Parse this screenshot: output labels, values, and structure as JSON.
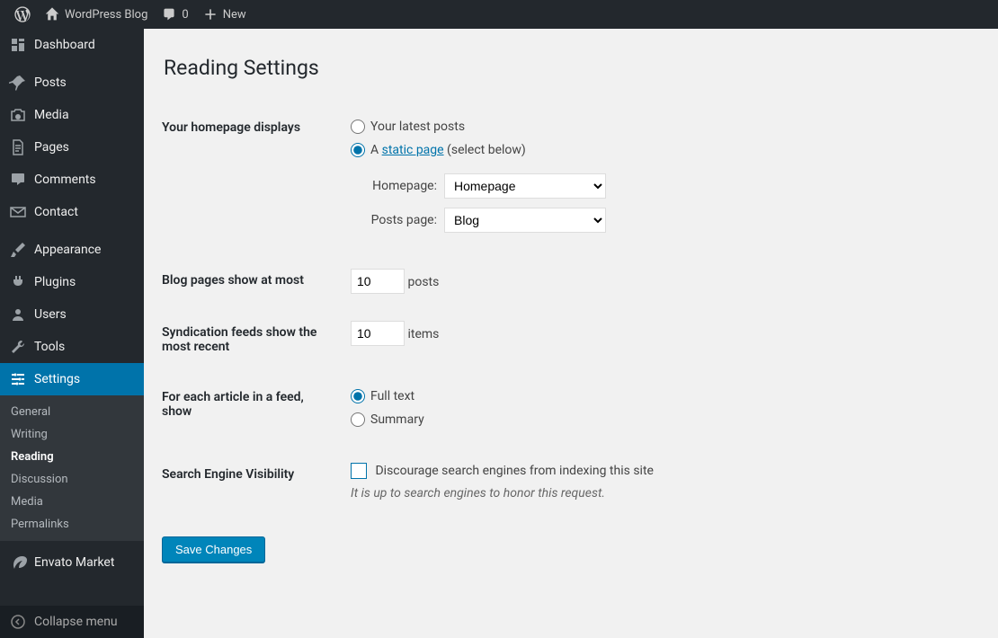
{
  "toolbar": {
    "site_name": "WordPress Blog",
    "comments_count": "0",
    "new_label": "New"
  },
  "sidebar": {
    "items": [
      {
        "label": "Dashboard"
      },
      {
        "label": "Posts"
      },
      {
        "label": "Media"
      },
      {
        "label": "Pages"
      },
      {
        "label": "Comments"
      },
      {
        "label": "Contact"
      },
      {
        "label": "Appearance"
      },
      {
        "label": "Plugins"
      },
      {
        "label": "Users"
      },
      {
        "label": "Tools"
      },
      {
        "label": "Settings"
      },
      {
        "label": "Envato Market"
      }
    ],
    "settings_sub": [
      {
        "label": "General"
      },
      {
        "label": "Writing"
      },
      {
        "label": "Reading"
      },
      {
        "label": "Discussion"
      },
      {
        "label": "Media"
      },
      {
        "label": "Permalinks"
      }
    ],
    "collapse_label": "Collapse menu"
  },
  "page": {
    "title": "Reading Settings",
    "homepage_th": "Your homepage displays",
    "homepage_opt_latest": "Your latest posts",
    "homepage_opt_static_prefix": "A ",
    "homepage_opt_static_link": "static page",
    "homepage_opt_static_suffix": " (select below)",
    "homepage_label": "Homepage:",
    "homepage_select": "Homepage",
    "posts_page_label": "Posts page:",
    "posts_page_select": "Blog",
    "blog_pages_th": "Blog pages show at most",
    "blog_pages_value": "10",
    "blog_pages_unit": "posts",
    "syndication_th": "Syndication feeds show the most recent",
    "syndication_value": "10",
    "syndication_unit": "items",
    "feed_article_th": "For each article in a feed, show",
    "feed_full": "Full text",
    "feed_summary": "Summary",
    "seo_th": "Search Engine Visibility",
    "seo_checkbox": "Discourage search engines from indexing this site",
    "seo_desc": "It is up to search engines to honor this request.",
    "save_button": "Save Changes"
  }
}
